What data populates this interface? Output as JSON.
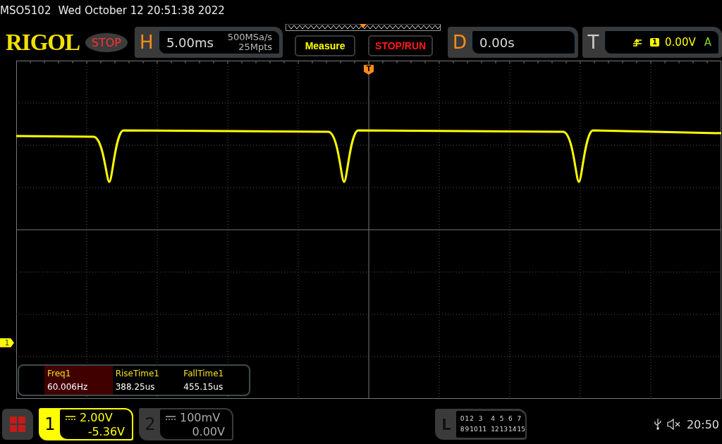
{
  "header": {
    "model": "MSO5102",
    "datetime": "Wed October 12 20:51:38 2022"
  },
  "toolbar": {
    "logo": "RIGOL",
    "run_state": "STOP",
    "horizontal": {
      "label": "H",
      "timebase": "5.00ms",
      "sample_rate": "500MSa/s",
      "memory_depth": "25Mpts"
    },
    "buttons": [
      "Measure",
      "STOP/RUN"
    ],
    "delay": {
      "label": "D",
      "value": "0.00s"
    },
    "trigger": {
      "label": "T",
      "channel": "1",
      "level": "0.00V",
      "mode": "A"
    }
  },
  "screen": {
    "trigger_marker": "T",
    "channel_marker": "1",
    "measurements": [
      {
        "name": "Freq1",
        "value": "60.006Hz",
        "selected": true
      },
      {
        "name": "RiseTime1",
        "value": "388.25us",
        "selected": false
      },
      {
        "name": "FallTime1",
        "value": "455.15us",
        "selected": false
      }
    ]
  },
  "channels": [
    {
      "number": "1",
      "scale": "2.00V",
      "offset": "-5.36V",
      "selected": true
    },
    {
      "number": "2",
      "scale": "100mV",
      "offset": "0.00V",
      "selected": false
    }
  ],
  "logic": {
    "label": "L",
    "bits": [
      "0",
      "1",
      "2",
      "3",
      "4",
      "5",
      "6",
      "7",
      "8",
      "9",
      "10",
      "11",
      "12",
      "13",
      "14",
      "15"
    ]
  },
  "status": {
    "time": "20:50"
  }
}
